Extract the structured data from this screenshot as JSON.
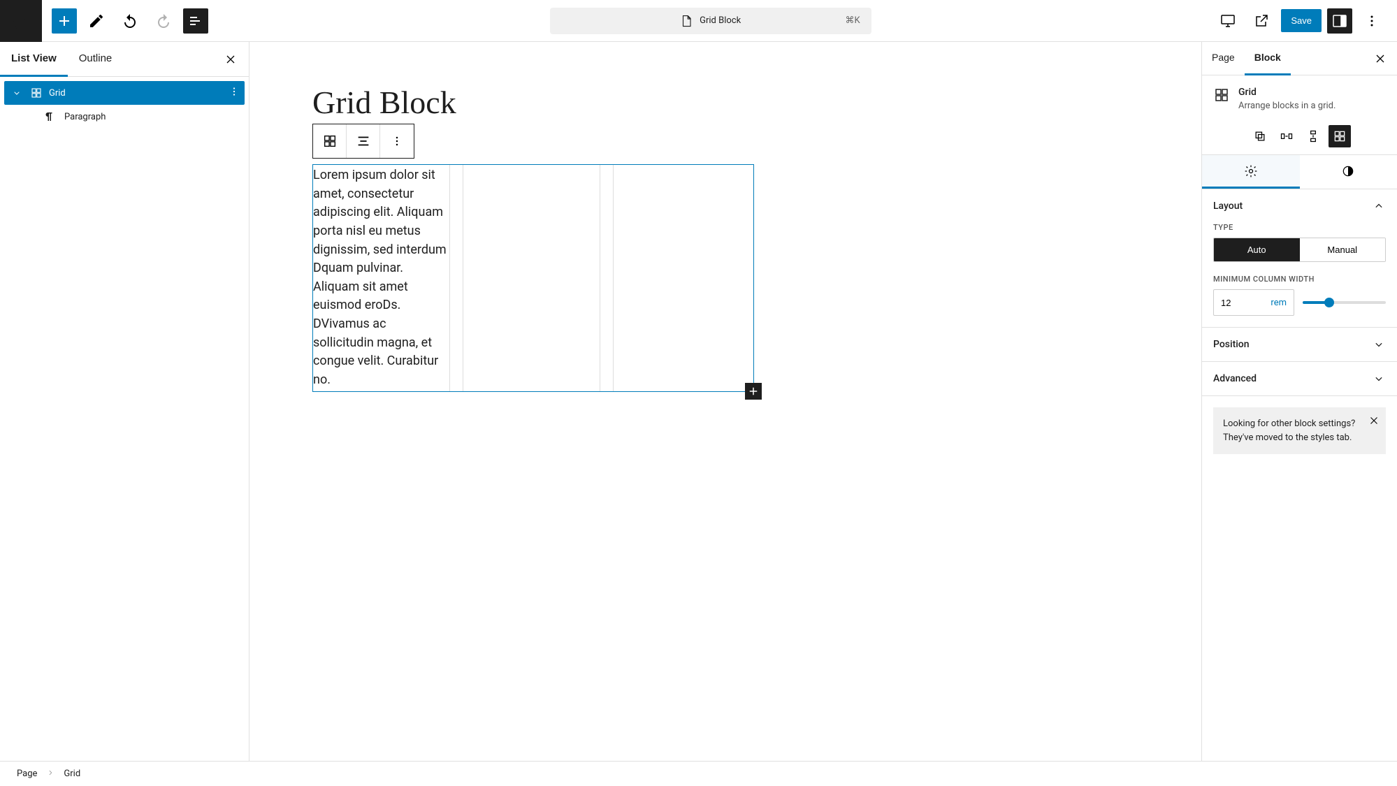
{
  "toolbar": {
    "doc_title": "Grid Block",
    "shortcut": "⌘K",
    "save_label": "Save"
  },
  "left": {
    "tabs": {
      "list_view": "List View",
      "outline": "Outline"
    },
    "tree": {
      "grid_label": "Grid",
      "paragraph_label": "Paragraph"
    }
  },
  "canvas": {
    "page_title": "Grid Block",
    "paragraph_text": "Lorem ipsum dolor sit amet, consectetur adipiscing elit. Aliquam porta nisl eu metus dignissim, sed interdum Dquam pulvinar. Aliquam sit amet euismod eroDs. DVivamus ac sollicitudin magna, et congue velit. Curabitur no."
  },
  "right": {
    "tabs": {
      "page": "Page",
      "block": "Block"
    },
    "block_header": {
      "title": "Grid",
      "desc": "Arrange blocks in a grid."
    },
    "layout": {
      "title": "Layout",
      "type_label": "Type",
      "auto": "Auto",
      "manual": "Manual",
      "min_width_label": "Minimum column width",
      "min_width_value": "12",
      "min_width_unit": "rem"
    },
    "position": {
      "title": "Position"
    },
    "advanced": {
      "title": "Advanced"
    },
    "notice": "Looking for other block settings? They've moved to the styles tab."
  },
  "footer": {
    "page": "Page",
    "grid": "Grid"
  }
}
